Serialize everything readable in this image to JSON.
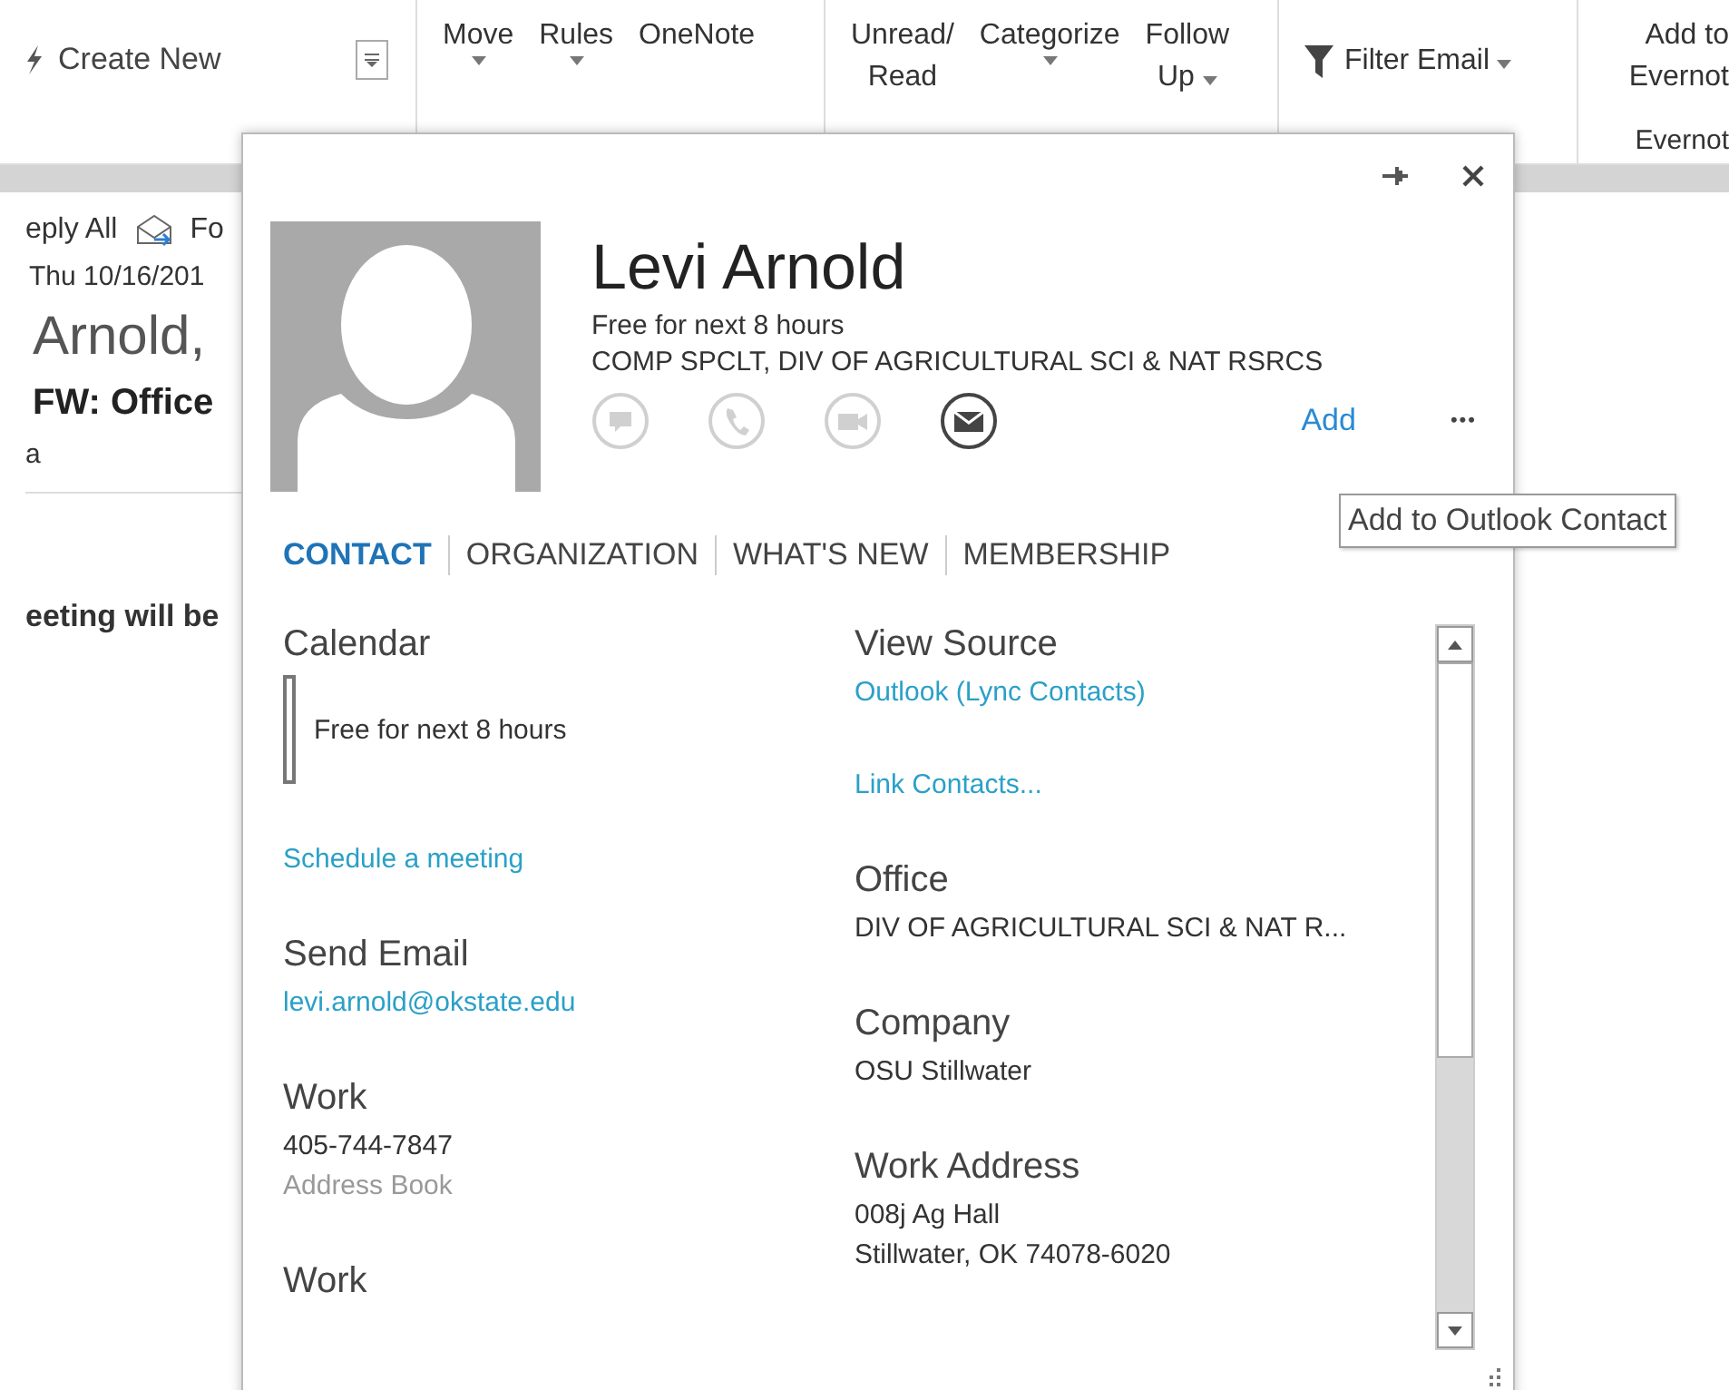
{
  "ribbon": {
    "quick_step": {
      "value": "Create New"
    },
    "groups": [
      {
        "buttons": [
          {
            "kind": "text",
            "lines": [
              "Move"
            ],
            "dropdown": true
          },
          {
            "kind": "text",
            "lines": [
              "Rules"
            ],
            "dropdown": true
          },
          {
            "kind": "text",
            "lines": [
              "OneNote"
            ],
            "dropdown": false
          }
        ]
      },
      {
        "buttons": [
          {
            "kind": "text",
            "lines": [
              "Unread/",
              "Read"
            ],
            "dropdown": false
          },
          {
            "kind": "text",
            "lines": [
              "Categorize"
            ],
            "dropdown": true
          },
          {
            "kind": "text",
            "lines": [
              "Follow",
              "Up"
            ],
            "dropdown": true
          }
        ]
      },
      {
        "buttons": [
          {
            "kind": "filter",
            "lines": [
              "Filter Email"
            ],
            "dropdown": true
          }
        ]
      },
      {
        "buttons": [
          {
            "kind": "text",
            "lines": [
              "Add to",
              "Evernot"
            ],
            "dropdown": false
          }
        ],
        "label": "Evernot"
      }
    ]
  },
  "message": {
    "reply_all": "eply All",
    "forward": "Fo",
    "date": "Thu 10/16/201",
    "sender": "Arnold,",
    "subject": "FW: Office",
    "attachment": "a",
    "body": "eeting will be"
  },
  "contact_card": {
    "name": "Levi Arnold",
    "status": "Free for next 8 hours",
    "title": "COMP SPCLT, DIV OF AGRICULTURAL SCI & NAT RSRCS",
    "actions": [
      {
        "kind": "chat",
        "disabled": true
      },
      {
        "kind": "call",
        "disabled": true
      },
      {
        "kind": "video",
        "disabled": true
      },
      {
        "kind": "email",
        "disabled": false
      }
    ],
    "add_link": "Add",
    "more": "•••",
    "tabs": [
      {
        "label": "CONTACT",
        "selected": true
      },
      {
        "label": "ORGANIZATION",
        "selected": false
      },
      {
        "label": "WHAT'S NEW",
        "selected": false
      },
      {
        "label": "MEMBERSHIP",
        "selected": false
      }
    ],
    "left_sections": [
      {
        "kind": "calendar",
        "heading": "Calendar",
        "lines": [
          {
            "kind": "text",
            "text": "Free for next 8 hours"
          }
        ]
      },
      {
        "kind": "plain",
        "lines": [
          {
            "kind": "link",
            "text": "Schedule a meeting"
          }
        ]
      },
      {
        "kind": "plain",
        "heading": "Send Email",
        "lines": [
          {
            "kind": "link",
            "text": "levi.arnold@okstate.edu"
          }
        ]
      },
      {
        "kind": "plain",
        "heading": "Work",
        "lines": [
          {
            "kind": "text",
            "text": "405-744-7847"
          },
          {
            "kind": "muted",
            "text": "Address Book"
          }
        ]
      },
      {
        "kind": "plain",
        "heading": "Work"
      }
    ],
    "right_sections": [
      {
        "kind": "plain",
        "heading": "View Source",
        "lines": [
          {
            "kind": "link",
            "text": "Outlook (Lync Contacts)"
          }
        ]
      },
      {
        "kind": "plain",
        "lines": [
          {
            "kind": "link",
            "text": "Link Contacts..."
          }
        ]
      },
      {
        "kind": "plain",
        "heading": "Office",
        "lines": [
          {
            "kind": "text",
            "text": "DIV OF AGRICULTURAL SCI & NAT R..."
          }
        ]
      },
      {
        "kind": "plain",
        "heading": "Company",
        "lines": [
          {
            "kind": "text",
            "text": "OSU Stillwater"
          }
        ]
      },
      {
        "kind": "plain",
        "heading": "Work Address",
        "lines": [
          {
            "kind": "text",
            "text": "008j Ag Hall"
          },
          {
            "kind": "text",
            "text": "Stillwater, OK 74078-6020"
          }
        ]
      }
    ]
  },
  "tooltip": "Add to Outlook Contact"
}
